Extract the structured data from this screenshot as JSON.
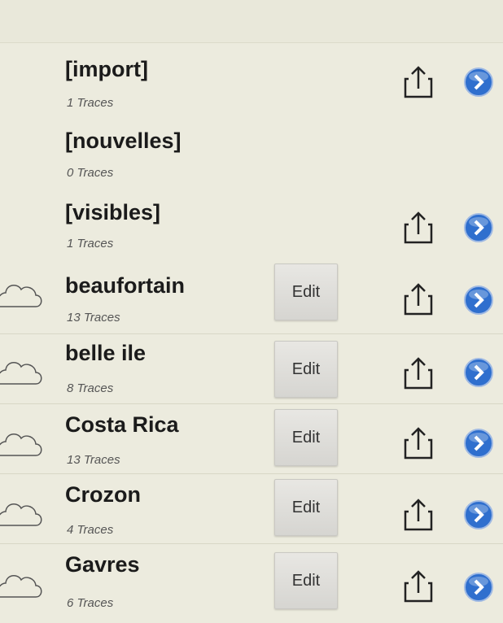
{
  "list": [
    {
      "title": "[import]",
      "traces": "1 Traces",
      "has_edit": false,
      "has_cloud": false,
      "has_share": true,
      "has_arrow": true
    },
    {
      "title": "[nouvelles]",
      "traces": "0 Traces",
      "has_edit": false,
      "has_cloud": false,
      "has_share": false,
      "has_arrow": false
    },
    {
      "title": "[visibles]",
      "traces": "1 Traces",
      "has_edit": false,
      "has_cloud": false,
      "has_share": true,
      "has_arrow": true
    },
    {
      "title": "beaufortain",
      "traces": "13 Traces",
      "has_edit": true,
      "has_cloud": true,
      "has_share": true,
      "has_arrow": true
    },
    {
      "title": "belle ile",
      "traces": "8 Traces",
      "has_edit": true,
      "has_cloud": true,
      "has_share": true,
      "has_arrow": true
    },
    {
      "title": "Costa Rica",
      "traces": "13 Traces",
      "has_edit": true,
      "has_cloud": true,
      "has_share": true,
      "has_arrow": true
    },
    {
      "title": "Crozon",
      "traces": "4 Traces",
      "has_edit": true,
      "has_cloud": true,
      "has_share": true,
      "has_arrow": true
    },
    {
      "title": "Gavres",
      "traces": "6 Traces",
      "has_edit": true,
      "has_cloud": true,
      "has_share": true,
      "has_arrow": true
    }
  ],
  "edit_label": "Edit",
  "icons": {
    "cloud": "cloud-icon",
    "share": "share-icon",
    "arrow": "chevron-right-circle-icon"
  },
  "colors": {
    "background": "#ecebde",
    "arrow_blue": "#2f6fce"
  }
}
